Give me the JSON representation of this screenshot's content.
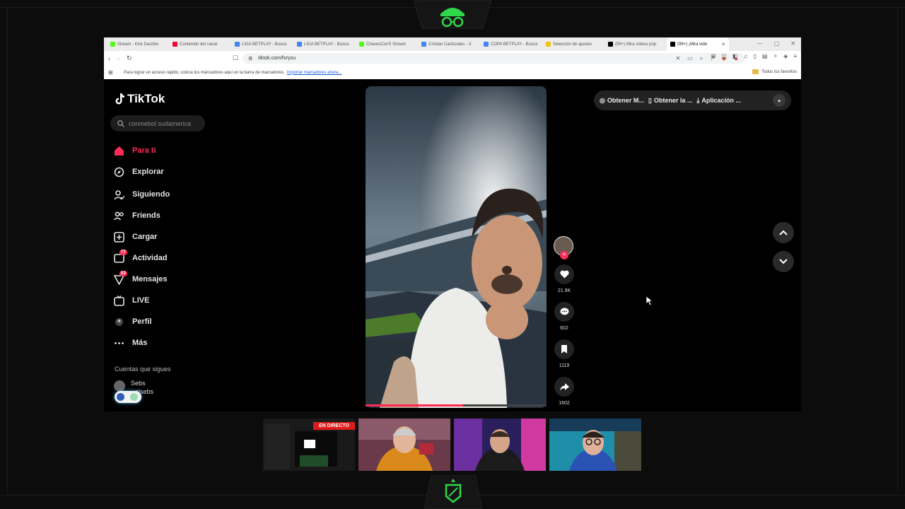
{
  "browser": {
    "tabs": [
      {
        "label": "Stream - Kick Dashbo",
        "color": "#53fc18"
      },
      {
        "label": "Contenido del canal",
        "color": "#ff0033"
      },
      {
        "label": "LIGA BETPLAY - Busca",
        "color": "#4285f4"
      },
      {
        "label": "LIGA BETPLAY - Busca",
        "color": "#4285f4"
      },
      {
        "label": "ChavesConS Stream",
        "color": "#53fc18"
      },
      {
        "label": "Cristian Carlsizales - X",
        "color": "#4285f4"
      },
      {
        "label": "COPA BETPLAY - Busca",
        "color": "#4285f4"
      },
      {
        "label": "Selección de ajustes",
        "color": "#f4c20d"
      },
      {
        "label": "(99+) Mira videos pop",
        "color": "#000000"
      },
      {
        "label": "(99+) ¡Mira vide",
        "color": "#000000"
      }
    ],
    "url": "tiktok.com/foryou",
    "bookmark_hint": "Para lograr un acceso rápido, coloca tus marcadores aquí en la barra de marcadores.",
    "bookmark_link": "Importar marcadores ahora...",
    "all_favorites": "Todos los favoritos"
  },
  "tiktok": {
    "logo": "TikTok",
    "search_placeholder": "conmebol sudamerica",
    "nav": [
      {
        "label": "Para ti",
        "icon": "home-icon",
        "active": true
      },
      {
        "label": "Explorar",
        "icon": "compass-icon"
      },
      {
        "label": "Siguiendo",
        "icon": "user-follow-icon"
      },
      {
        "label": "Friends",
        "icon": "friends-icon"
      },
      {
        "label": "Cargar",
        "icon": "upload-icon"
      },
      {
        "label": "Actividad",
        "icon": "activity-icon",
        "badge": "77"
      },
      {
        "label": "Mensajes",
        "icon": "messages-icon",
        "badge": "53"
      },
      {
        "label": "LIVE",
        "icon": "live-icon"
      },
      {
        "label": "Perfil",
        "icon": "profile-icon"
      },
      {
        "label": "Más",
        "icon": "more-icon"
      }
    ],
    "following_title": "Cuentas que sigues",
    "following_name_1": "Sebs",
    "following_name_2": "alsebs",
    "likes": "21.9K",
    "comments": "602",
    "saves": "1119",
    "shares": "1602",
    "video_progress": 0.54,
    "topbar": {
      "item1": "Obtener M...",
      "item2": "Obtener la ...",
      "item3": "Aplicación ..."
    }
  },
  "overlay": {
    "live_badge": "EN DIRECTO"
  },
  "colors": {
    "accent": "#fe2c55",
    "hud_green": "#2fd84a"
  }
}
